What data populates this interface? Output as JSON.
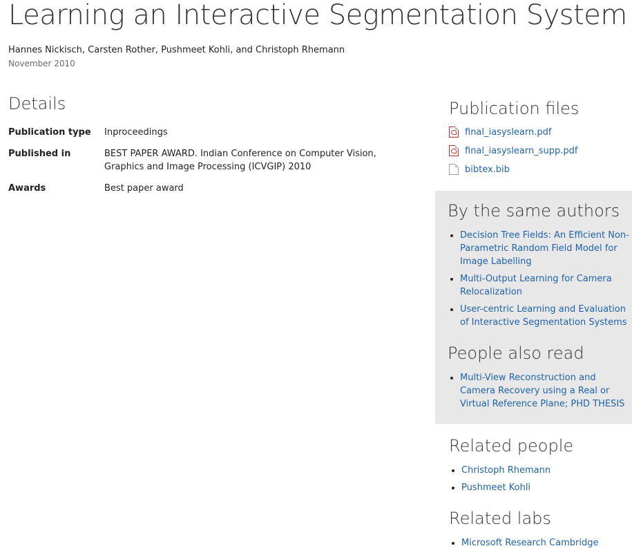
{
  "publication": {
    "title": "Learning an Interactive Segmentation System",
    "authors": "Hannes Nickisch, Carsten Rother, Pushmeet Kohli, and Christoph Rhemann",
    "date": "November 2010"
  },
  "details": {
    "heading": "Details",
    "rows": [
      {
        "label": "Publication type",
        "value": "Inproceedings"
      },
      {
        "label": "Published in",
        "value": "BEST PAPER AWARD. Indian Conference on Computer Vision, Graphics and Image Processing (ICVGIP) 2010"
      },
      {
        "label": "Awards",
        "value": "Best paper award"
      }
    ]
  },
  "files": {
    "heading": "Publication files",
    "items": [
      {
        "name": "final_iasyslearn.pdf",
        "icon": "pdf-icon"
      },
      {
        "name": "final_iasyslearn_supp.pdf",
        "icon": "pdf-icon"
      },
      {
        "name": "bibtex.bib",
        "icon": "file-icon"
      }
    ]
  },
  "same_authors": {
    "heading": "By the same authors",
    "items": [
      "Decision Tree Fields: An Efficient Non-Parametric Random Field Model for Image Labelling",
      "Multi-Output Learning for Camera Relocalization",
      "User-centric Learning and Evaluation of Interactive Segmentation Systems"
    ]
  },
  "also_read": {
    "heading": "People also read",
    "items": [
      "Multi-View Reconstruction and Camera Recovery using a Real or Virtual Reference Plane; PHD THESIS"
    ]
  },
  "related_people": {
    "heading": "Related people",
    "items": [
      "Christoph Rhemann",
      "Pushmeet Kohli"
    ]
  },
  "related_labs": {
    "heading": "Related labs",
    "items": [
      "Microsoft Research Cambridge"
    ]
  },
  "colors": {
    "link": "#1e63a8",
    "sidebar_bg": "#e8e8e8",
    "pdf_icon": "#c0392b"
  }
}
